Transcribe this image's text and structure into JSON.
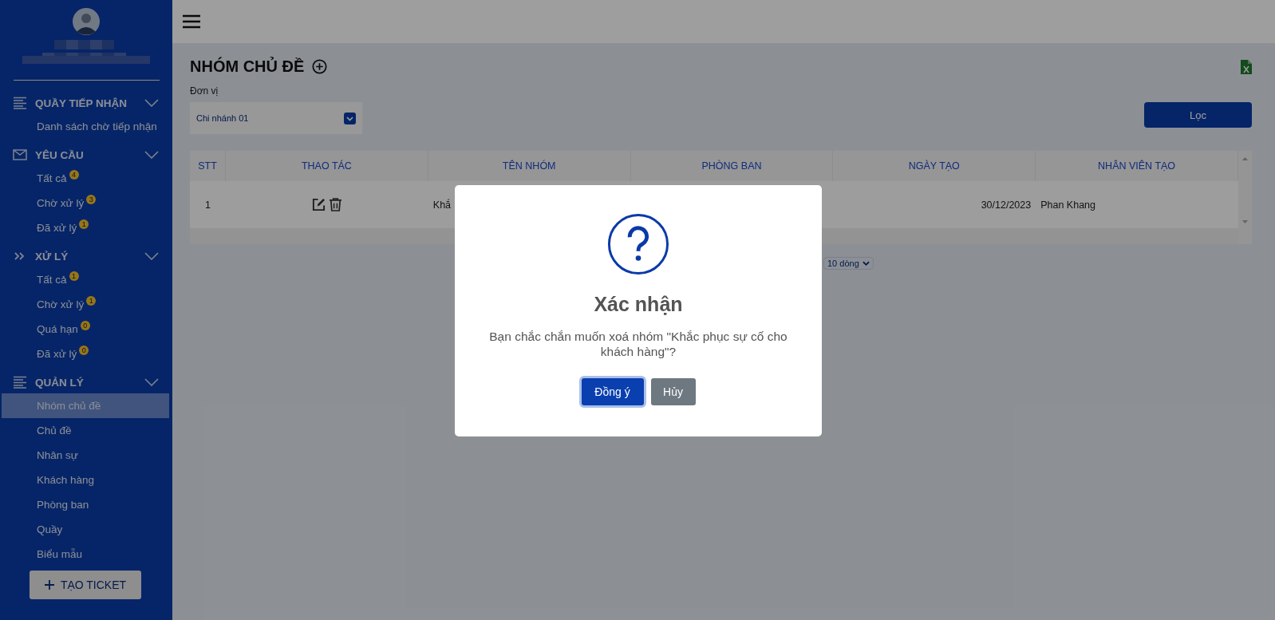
{
  "sidebar": {
    "sections": [
      {
        "kind": "list",
        "title": "QUẦY TIẾP NHẬN",
        "expanded": true,
        "items": [
          {
            "label": "Danh sách chờ tiếp nhận",
            "selected": false
          }
        ]
      },
      {
        "kind": "mail",
        "title": "YÊU CẦU",
        "expanded": true,
        "items": [
          {
            "label": "Tất cả",
            "badge": "4",
            "selected": false
          },
          {
            "label": "Chờ xử lý",
            "badge": "3",
            "selected": false
          },
          {
            "label": "Đã xử lý",
            "badge": "1",
            "selected": false
          }
        ]
      },
      {
        "kind": "chevrons",
        "title": "XỬ LÝ",
        "expanded": true,
        "items": [
          {
            "label": "Tất cả",
            "badge": "1",
            "selected": false
          },
          {
            "label": "Chờ xử lý",
            "badge": "1",
            "selected": false
          },
          {
            "label": "Quá hạn",
            "badge": "0",
            "selected": false
          },
          {
            "label": "Đã xử lý",
            "badge": "0",
            "selected": false
          }
        ]
      },
      {
        "kind": "list",
        "title": "QUẢN LÝ",
        "expanded": true,
        "items": [
          {
            "label": "Nhóm chủ đề",
            "selected": true
          },
          {
            "label": "Chủ đề",
            "selected": false
          },
          {
            "label": "Nhân sự",
            "selected": false
          },
          {
            "label": "Khách hàng",
            "selected": false
          },
          {
            "label": "Phòng ban",
            "selected": false
          },
          {
            "label": "Quầy",
            "selected": false
          },
          {
            "label": "Biểu mẫu",
            "selected": false
          }
        ]
      }
    ],
    "create_button": "TẠO TICKET"
  },
  "page": {
    "title": "NHÓM CHỦ ĐỀ",
    "filter": {
      "label": "Đơn vị",
      "value": "Chi nhánh 01"
    },
    "filter_button": "Lọc"
  },
  "table": {
    "columns": [
      "STT",
      "THAO TÁC",
      "TÊN NHÓM",
      "PHÒNG BAN",
      "NGÀY TẠO",
      "NHÂN VIÊN TẠO"
    ],
    "rows": [
      {
        "stt": "1",
        "name": "Khắ",
        "department": "",
        "created": "30/12/2023",
        "creator": "Phan Khang"
      }
    ]
  },
  "pagination": {
    "page_size": "10 dòng"
  },
  "dialog": {
    "title": "Xác nhận",
    "message": "Bạn chắc chắn muốn xoá nhóm \"Khắc phục sự cố cho khách hàng\"?",
    "confirm": "Đồng ý",
    "cancel": "Hủy"
  }
}
